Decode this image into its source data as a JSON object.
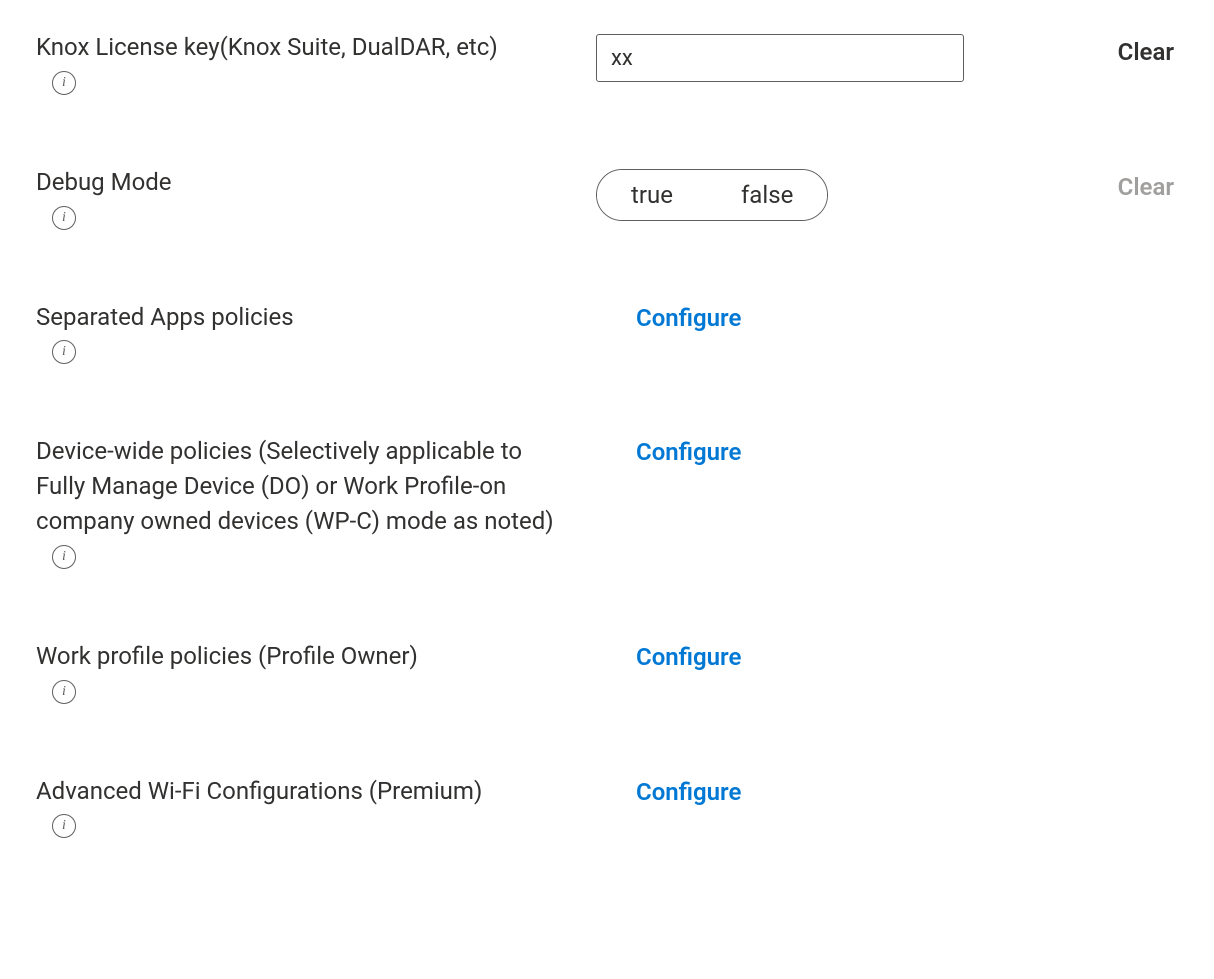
{
  "rows": {
    "knox_license": {
      "label": "Knox License key(Knox Suite, DualDAR, etc)",
      "input_value": "xx",
      "clear_label": "Clear"
    },
    "debug_mode": {
      "label": "Debug Mode",
      "option_true": "true",
      "option_false": "false",
      "clear_label": "Clear"
    },
    "separated_apps": {
      "label": "Separated Apps policies",
      "configure_label": "Configure"
    },
    "device_wide": {
      "label": "Device-wide policies (Selectively applicable to Fully Manage Device (DO) or Work Profile-on company owned devices (WP-C) mode as noted)",
      "configure_label": "Configure"
    },
    "work_profile": {
      "label": "Work profile policies (Profile Owner)",
      "configure_label": "Configure"
    },
    "wifi_config": {
      "label": "Advanced Wi-Fi Configurations (Premium)",
      "configure_label": "Configure"
    }
  }
}
